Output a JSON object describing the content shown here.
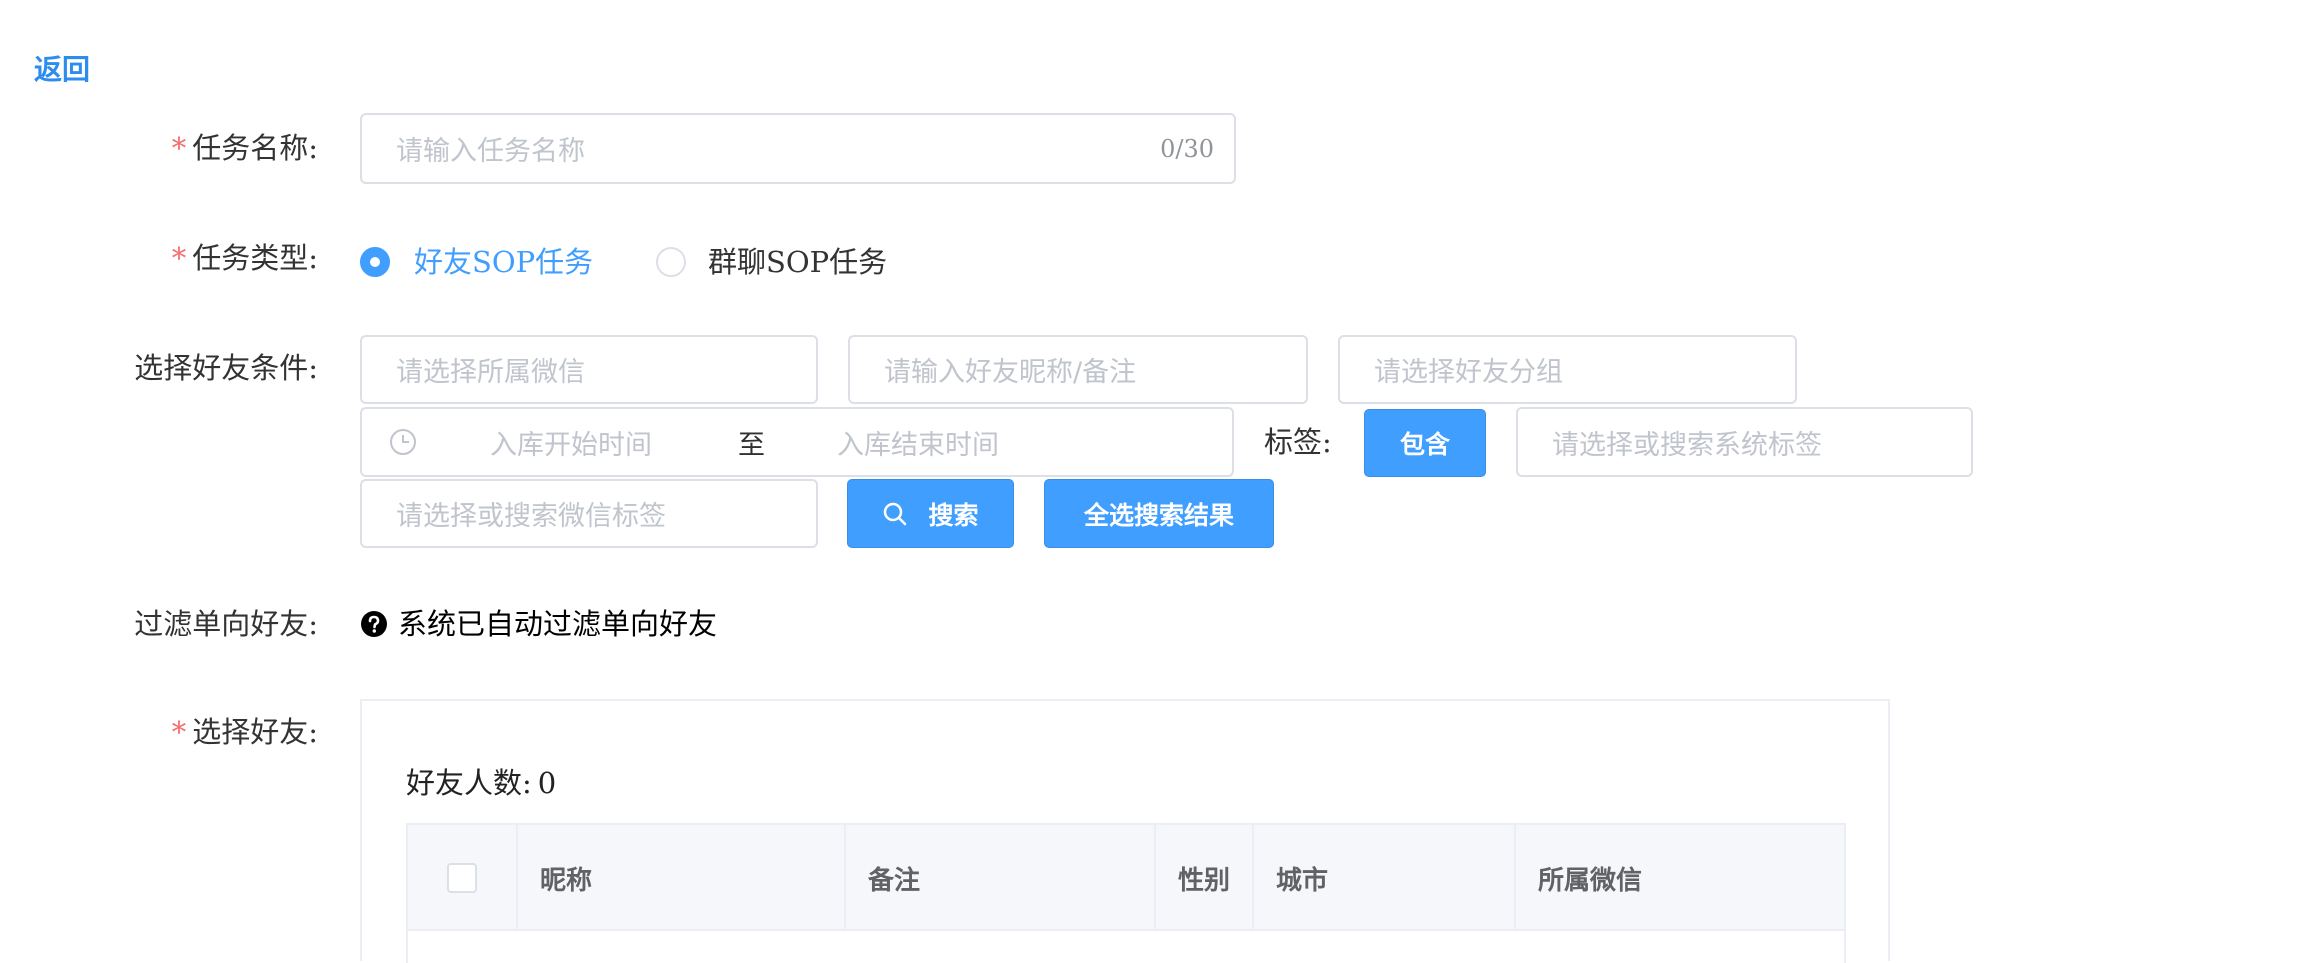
{
  "back": "返回",
  "task_name": {
    "label": "任务名称:",
    "placeholder": "请输入任务名称",
    "counter": "0/30"
  },
  "task_type": {
    "label": "任务类型:",
    "options": [
      "好友SOP任务",
      "群聊SOP任务"
    ],
    "selected": 0
  },
  "filter": {
    "label": "选择好友条件:",
    "wechat_placeholder": "请选择所属微信",
    "nickname_placeholder": "请输入好友昵称/备注",
    "group_placeholder": "请选择好友分组",
    "start_placeholder": "入库开始时间",
    "range_sep": "至",
    "end_placeholder": "入库结束时间",
    "tag_label": "标签:",
    "tag_mode": "包含",
    "system_tag_placeholder": "请选择或搜索系统标签",
    "wechat_tag_placeholder": "请选择或搜索微信标签",
    "search_button": "搜索",
    "select_all_button": "全选搜索结果"
  },
  "one_way": {
    "label": "过滤单向好友:",
    "text": "系统已自动过滤单向好友"
  },
  "select_friends": {
    "label": "选择好友:",
    "count_label": "好友人数:",
    "count": "0",
    "columns": [
      "昵称",
      "备注",
      "性别",
      "城市",
      "所属微信"
    ]
  },
  "colors": {
    "primary": "#409eff",
    "required": "#f56c6c",
    "border": "#dcdfe6"
  }
}
